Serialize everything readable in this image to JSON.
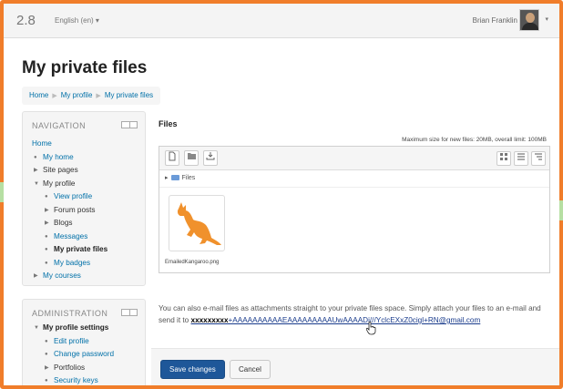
{
  "header": {
    "version": "2.8",
    "language": "English (en) ▾",
    "user_name": "Brian Franklin",
    "user_caret": "▾"
  },
  "page_title": "My private files",
  "breadcrumb": [
    "Home",
    "My profile",
    "My private files"
  ],
  "navigation": {
    "title": "NAVIGATION",
    "items": [
      {
        "label": "Home"
      },
      {
        "label": "My home"
      },
      {
        "label": "Site pages"
      },
      {
        "label": "My profile"
      },
      {
        "label": "View profile"
      },
      {
        "label": "Forum posts"
      },
      {
        "label": "Blogs"
      },
      {
        "label": "Messages"
      },
      {
        "label": "My private files"
      },
      {
        "label": "My badges"
      },
      {
        "label": "My courses"
      }
    ]
  },
  "administration": {
    "title": "ADMINISTRATION",
    "items": [
      {
        "label": "My profile settings"
      },
      {
        "label": "Edit profile"
      },
      {
        "label": "Change password"
      },
      {
        "label": "Portfolios"
      },
      {
        "label": "Security keys"
      }
    ]
  },
  "files": {
    "label": "Files",
    "max_size": "Maximum size for new files: 20MB, overall limit: 100MB",
    "path_folder": "Files",
    "file_name": "EmailedKangaroo.png"
  },
  "email": {
    "text": "You can also e-mail files as attachments straight to your private files space. Simply attach your files to an e-mail and send it to",
    "address_hidden": "xxxxxxxxx",
    "address": "+AAAAAAAAAAEAAAAAAAAAUwAAAADi///YclcEXxZ0cigl+RN@gmail.com"
  },
  "buttons": {
    "save": "Save changes",
    "cancel": "Cancel"
  },
  "colors": {
    "frame": "#f07d2a",
    "link": "#0070a8",
    "save_button": "#1e5799",
    "kangaroo": "#f0912c"
  }
}
